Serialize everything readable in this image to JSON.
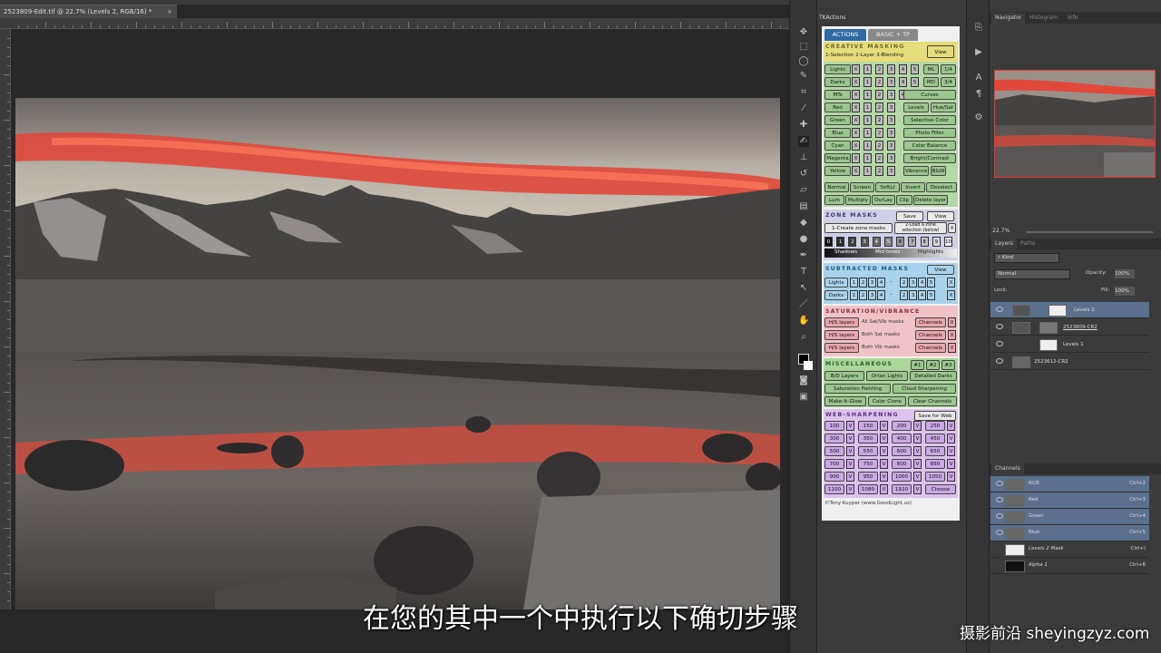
{
  "document": {
    "tab_title": "2523809-Edit.tif @ 22.7% (Levels 2, RGB/16) *",
    "close": "×"
  },
  "tkactions": {
    "panel_title": "TKActions",
    "tabs": [
      "ACTIONS",
      "BASIC + TP"
    ],
    "creative_masking": {
      "title": "CREATIVE MASKING",
      "subtitle": "1-Selection 2-Layer 3-Blending",
      "view": "View",
      "rows": [
        {
          "label": "Lights",
          "x": "X",
          "nums": [
            "1",
            "2",
            "3",
            "4",
            "5"
          ],
          "extra": [
            "ML",
            "1/4"
          ]
        },
        {
          "label": "Darks",
          "x": "X",
          "nums": [
            "1",
            "2",
            "3",
            "4",
            "5"
          ],
          "extra": [
            "MD",
            "3/4"
          ]
        },
        {
          "label": "MTs",
          "x": "X",
          "nums": [
            "1",
            "2",
            "3",
            "4",
            "5"
          ],
          "extra": [
            "Curves"
          ]
        },
        {
          "label": "Red",
          "x": "X",
          "nums": [
            "1",
            "2",
            "3"
          ],
          "extra": [
            "Levels",
            "Hue/Sat"
          ]
        },
        {
          "label": "Green",
          "x": "X",
          "nums": [
            "1",
            "2",
            "3"
          ],
          "extra": [
            "Selective Color"
          ]
        },
        {
          "label": "Blue",
          "x": "X",
          "nums": [
            "1",
            "2",
            "3"
          ],
          "extra": [
            "Photo Filter"
          ]
        },
        {
          "label": "Cyan",
          "x": "X",
          "nums": [
            "1",
            "2",
            "3"
          ],
          "extra": [
            "Color Balance"
          ]
        },
        {
          "label": "Magenta",
          "x": "X",
          "nums": [
            "1",
            "2",
            "3"
          ],
          "extra": [
            "Bright/Contrast"
          ]
        },
        {
          "label": "Yellow",
          "x": "X",
          "nums": [
            "1",
            "2",
            "3"
          ],
          "extra": [
            "Vibrance",
            "B&W"
          ]
        }
      ],
      "blend_row1": [
        "Normal",
        "Screen",
        "SoftLt",
        "Invert",
        "Deselect"
      ],
      "blend_row2": [
        "Lum",
        "Multiply",
        "OvrLay",
        "Clip",
        "Delete layer"
      ]
    },
    "zone_masks": {
      "title": "ZONE MASKS",
      "save": "Save",
      "view": "View",
      "create": "1-Create zone masks",
      "load": "2-Load a zone selection (below)",
      "x": "X",
      "zones": [
        "0",
        "1",
        "2",
        "3",
        "4",
        "5",
        "6",
        "7",
        "8",
        "9",
        "10"
      ],
      "labels": [
        "Shadows",
        "Mid-tones",
        "Highlights"
      ]
    },
    "subtracted_masks": {
      "title": "SUBTRACTED MASKS",
      "view": "View",
      "rows": [
        {
          "label": "Lights",
          "left": [
            "1",
            "2",
            "3",
            "4"
          ],
          "dash": "–",
          "right": [
            "2",
            "3",
            "4",
            "5"
          ],
          "x": "X"
        },
        {
          "label": "Darks",
          "left": [
            "1",
            "2",
            "3",
            "4"
          ],
          "dash": "–",
          "right": [
            "2",
            "3",
            "4",
            "5"
          ],
          "x": "X"
        }
      ]
    },
    "saturation": {
      "title": "SATURATION/VIBRANCE",
      "rows": [
        {
          "btn": "H/S layers",
          "text": "All Sat/Vib masks",
          "ch": "Channels",
          "x": "X"
        },
        {
          "btn": "H/S layers",
          "text": "Both Sat masks",
          "ch": "Channels",
          "x": "X"
        },
        {
          "btn": "H/S layers",
          "text": "Both Vib masks",
          "ch": "Channels",
          "x": "X"
        }
      ]
    },
    "misc": {
      "title": "MISCELLANEOUS",
      "presets": [
        "#1",
        "#2",
        "#3"
      ],
      "rows": [
        [
          "B/D Layers",
          "Orton Lights",
          "Detailed Darks"
        ],
        [
          "Saturation Painting",
          "Cloud Sharpening"
        ],
        [
          "Make-It-Glow",
          "Color Clone",
          "Clear Channels"
        ]
      ]
    },
    "web": {
      "title": "WEB-SHARPENING",
      "save": "Save for Web",
      "rows": [
        [
          "100",
          "150",
          "200",
          "250"
        ],
        [
          "300",
          "350",
          "400",
          "450"
        ],
        [
          "500",
          "550",
          "600",
          "650"
        ],
        [
          "700",
          "750",
          "800",
          "850"
        ],
        [
          "900",
          "950",
          "1000",
          "1050"
        ],
        [
          "1100",
          "1080",
          "1920"
        ]
      ],
      "v": "V",
      "choose": "Choose"
    },
    "copyright": "©Tony Kuyper (www.GoodLight.us)"
  },
  "navigator": {
    "tabs": [
      "Navigator",
      "Histogram",
      "Info"
    ],
    "zoom": "22.7%"
  },
  "layers": {
    "tabs": [
      "Layers",
      "Paths"
    ],
    "kind": "Kind",
    "blend": "Normal",
    "opacity_label": "Opacity:",
    "opacity": "100%",
    "lock_label": "Lock:",
    "fill_label": "Fill:",
    "fill": "100%",
    "items": [
      "Levels 2",
      "2523809-CR2",
      "Levels 1",
      "2523612-CR2"
    ]
  },
  "channels": {
    "tab": "Channels",
    "items": [
      {
        "name": "RGB",
        "key": "Ctrl+2"
      },
      {
        "name": "Red",
        "key": "Ctrl+3"
      },
      {
        "name": "Green",
        "key": "Ctrl+4"
      },
      {
        "name": "Blue",
        "key": "Ctrl+5"
      },
      {
        "name": "Levels 2 Mask",
        "key": "Ctrl+\\"
      },
      {
        "name": "Alpha 1",
        "key": "Ctrl+6"
      }
    ]
  },
  "subtitle": "在您的其中一个中执行以下确切步骤",
  "watermark": "摄影前沿 sheyingzyz.com",
  "colors": {
    "tk_green": "#9ac78e",
    "tk_yellow": "#e6dc7a",
    "tk_purple": "#cba8e6",
    "tk_blue": "#a9d3ec",
    "tk_pink": "#e8a7ae",
    "sky_glow": "#e84a3a"
  }
}
